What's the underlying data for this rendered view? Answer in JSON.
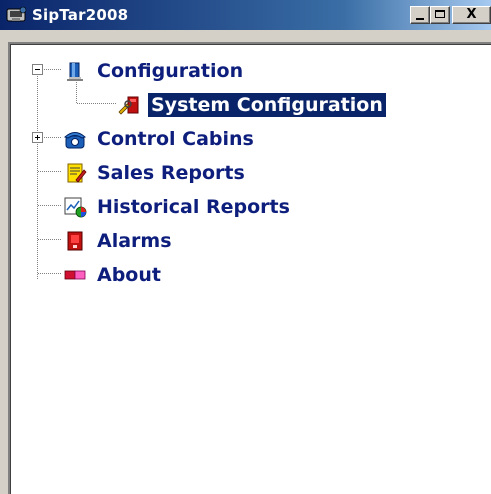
{
  "window": {
    "title": "SipTar2008",
    "minimize_icon": "minimize-icon",
    "maximize_icon": "maximize-icon",
    "close_glyph": "X"
  },
  "tree": {
    "items": [
      {
        "label": "Configuration",
        "icon": "book-icon",
        "expanded": true
      },
      {
        "label": "System Configuration",
        "icon": "tools-icon",
        "selected": true
      },
      {
        "label": "Control Cabins",
        "icon": "telephone-icon",
        "expanded": false
      },
      {
        "label": "Sales Reports",
        "icon": "report-icon"
      },
      {
        "label": "Historical Reports",
        "icon": "chart-icon"
      },
      {
        "label": "Alarms",
        "icon": "alarm-icon"
      },
      {
        "label": "About",
        "icon": "about-icon"
      }
    ]
  },
  "colors": {
    "titlebar": "#0a246a",
    "label": "#0d1e7c",
    "selection": "#0a246a"
  }
}
